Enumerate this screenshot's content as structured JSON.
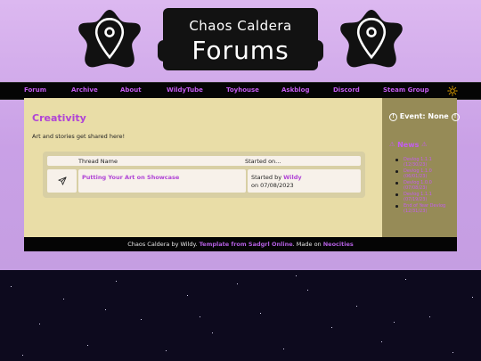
{
  "site": {
    "title_top": "Chaos Caldera",
    "title_main": "Forums"
  },
  "nav": {
    "items": [
      {
        "label": "Forum"
      },
      {
        "label": "Archive"
      },
      {
        "label": "About"
      },
      {
        "label": "WildyTube"
      },
      {
        "label": "Toyhouse"
      },
      {
        "label": "Askblog"
      },
      {
        "label": "Discord"
      },
      {
        "label": "Steam Group"
      }
    ],
    "theme_icon": "sun-icon"
  },
  "main": {
    "title": "Creativity",
    "description": "Art and stories get shared here!",
    "table": {
      "headers": [
        "Thread Name",
        "Started on..."
      ],
      "rows": [
        {
          "icon": "send-icon",
          "thread": "Putting Your Art on Showcase",
          "started_prefix": "Started by ",
          "user": "Wildy",
          "date": "on 07/08/2023"
        }
      ]
    }
  },
  "sidebar": {
    "event_label": "Event: None",
    "news_title": "News",
    "news_items": [
      "Devlog 1.1.1 (12/30/23)",
      "Devlog 1.1.0 (06/01/23)",
      "Devlog 1.0.0 (07/08/23)",
      "Devlog 1.1.1 (07/19/23)",
      "End of Year Devlog (12/31/23)"
    ]
  },
  "footer": {
    "prefix": "Chaos Caldera by Wildy. ",
    "template_link": "Template from Sadgrl Online",
    "middle": ". Made on ",
    "host_link": "Neocities"
  },
  "colors": {
    "accent": "#c45cf0",
    "main_bg": "#e9dda7",
    "sidebar_bg": "#968b57",
    "nav_bg": "#050505"
  }
}
